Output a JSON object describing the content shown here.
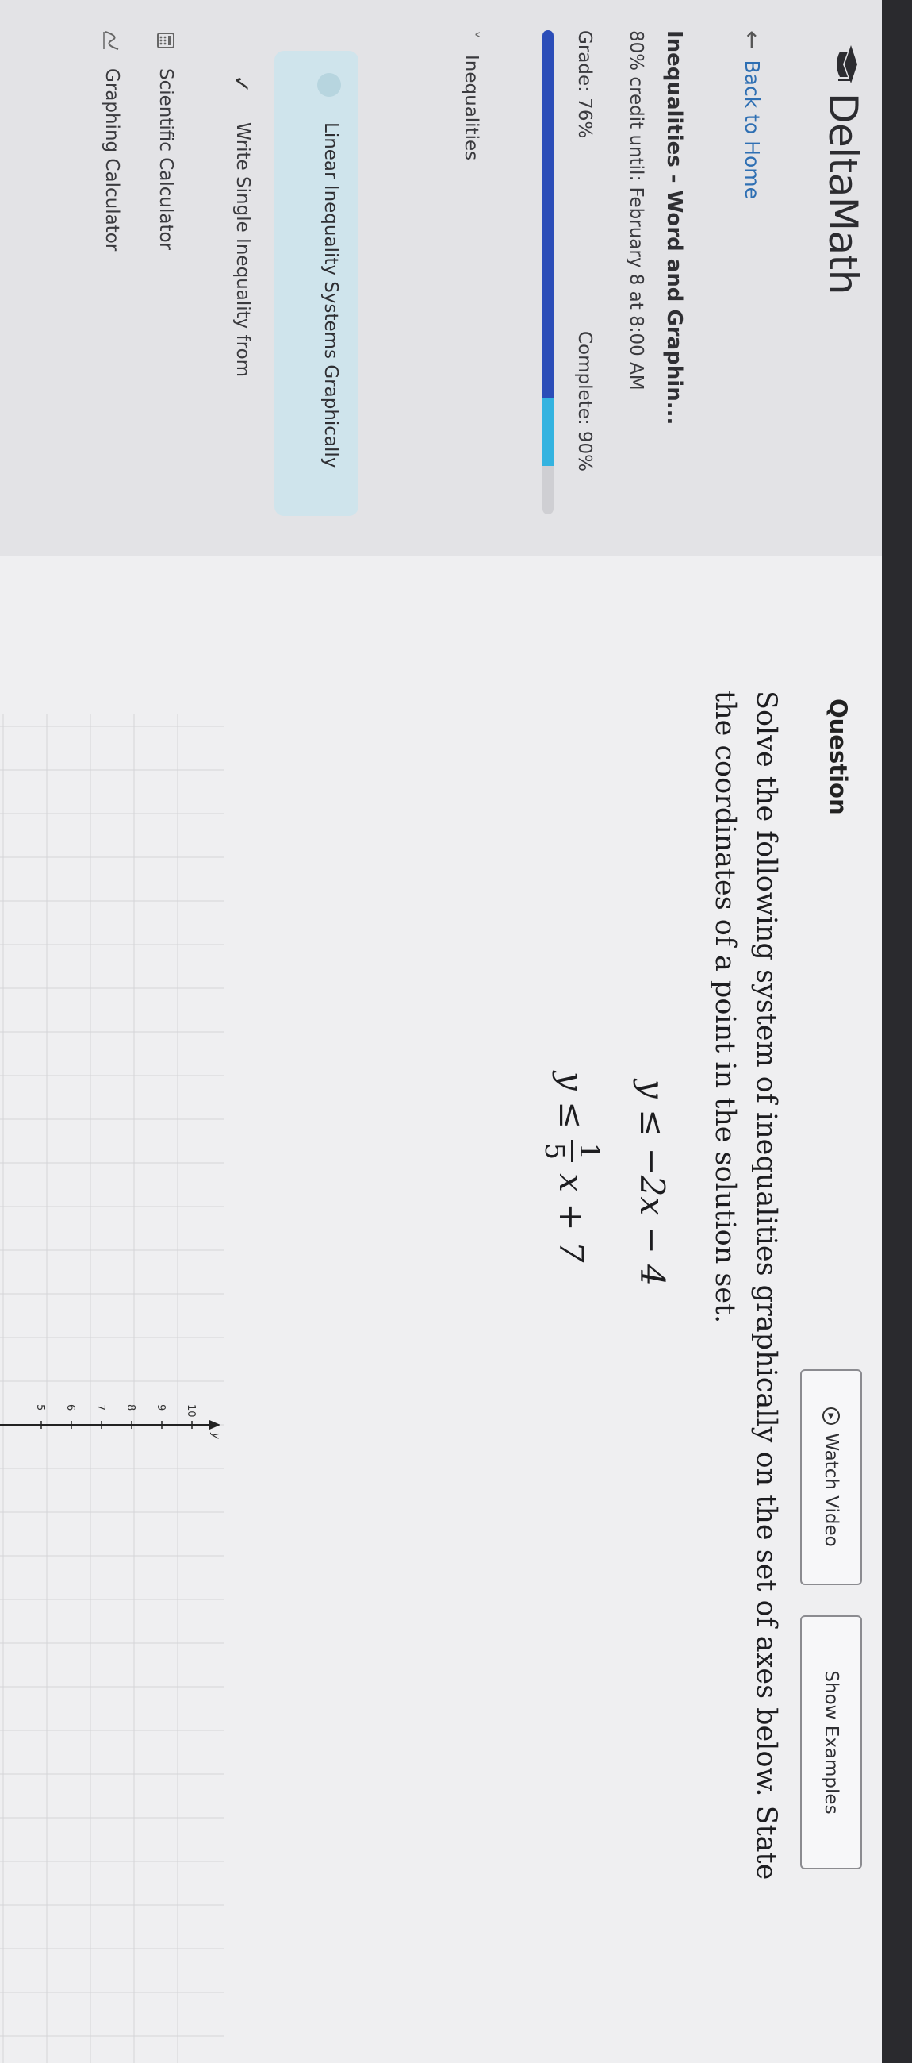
{
  "brand": {
    "name": "DeltaMath",
    "logo_icon": "deltamath-logo-icon"
  },
  "sidebar": {
    "back_link": "Back to Home",
    "assignment_title": "Inequalities - Word and Graphin...",
    "credit_until": "80% credit until: February 8 at 8:00 AM",
    "grade_text": "Grade: 76%",
    "complete_text": "Complete: 90%",
    "grade_value": 76,
    "complete_value": 90,
    "section_label": "Inequalities",
    "active_item": "Linear Inequality Systems Graphically",
    "completed_item": "Write Single Inequality from",
    "tools": [
      {
        "label": "Scientific Calculator",
        "icon": "calculator-icon"
      },
      {
        "label": "Graphing Calculator",
        "icon": "graph-icon"
      }
    ]
  },
  "question": {
    "heading": "Question",
    "watch_video": "Watch Video",
    "show_examples": "Show Examples",
    "prompt": "Solve the following system of inequalities graphically on the set of axes below. State the coordinates of a point in the solution set.",
    "eq1": "y ≤ −2x − 4",
    "eq2_lhs": "y ≤",
    "eq2_num": "1",
    "eq2_den": "5",
    "eq2_rhs": "x + 7"
  },
  "graph": {
    "axis_label": "y",
    "y_ticks": [
      "10",
      "9",
      "8",
      "7",
      "6",
      "5"
    ]
  },
  "colors": {
    "grade_bar": "#2b4db8",
    "complete_bar": "#34b3e0",
    "link": "#2e6fb3",
    "active_bg": "#cfe4ec"
  }
}
